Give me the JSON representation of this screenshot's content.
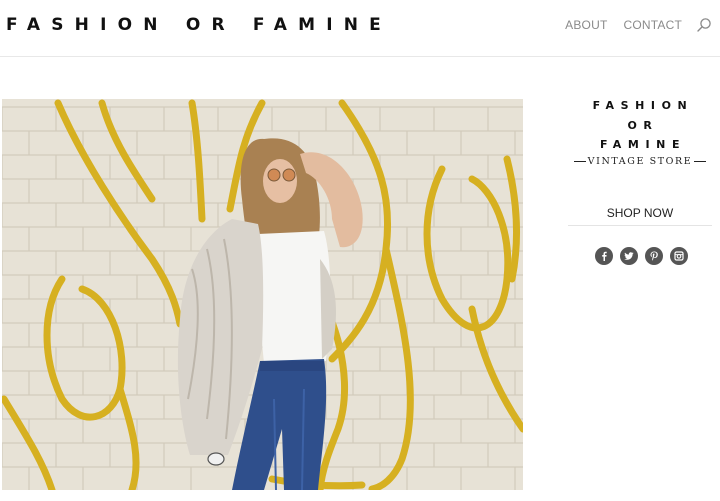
{
  "header": {
    "logo": "FASHION OR FAMINE",
    "nav": [
      {
        "label": "ABOUT"
      },
      {
        "label": "CONTACT"
      }
    ],
    "search_icon": "search-icon"
  },
  "hero": {
    "image": "photo of woman in fur coat and jeans in front of a white brick wall with yellow graffiti"
  },
  "sidebar": {
    "brand_lines": [
      "FASHION",
      "OR",
      "FAMINE"
    ],
    "brand_sub": "VINTAGE STORE",
    "shop_label": "SHOP NOW",
    "social": [
      {
        "icon": "facebook-icon"
      },
      {
        "icon": "twitter-icon"
      },
      {
        "icon": "pinterest-icon"
      },
      {
        "icon": "instagram-icon"
      }
    ]
  },
  "colors": {
    "text": "#111111",
    "nav": "#8a8a8a",
    "social_bg": "#555555",
    "graffiti": "#d9b21a",
    "wall": "#e9e4d8"
  }
}
